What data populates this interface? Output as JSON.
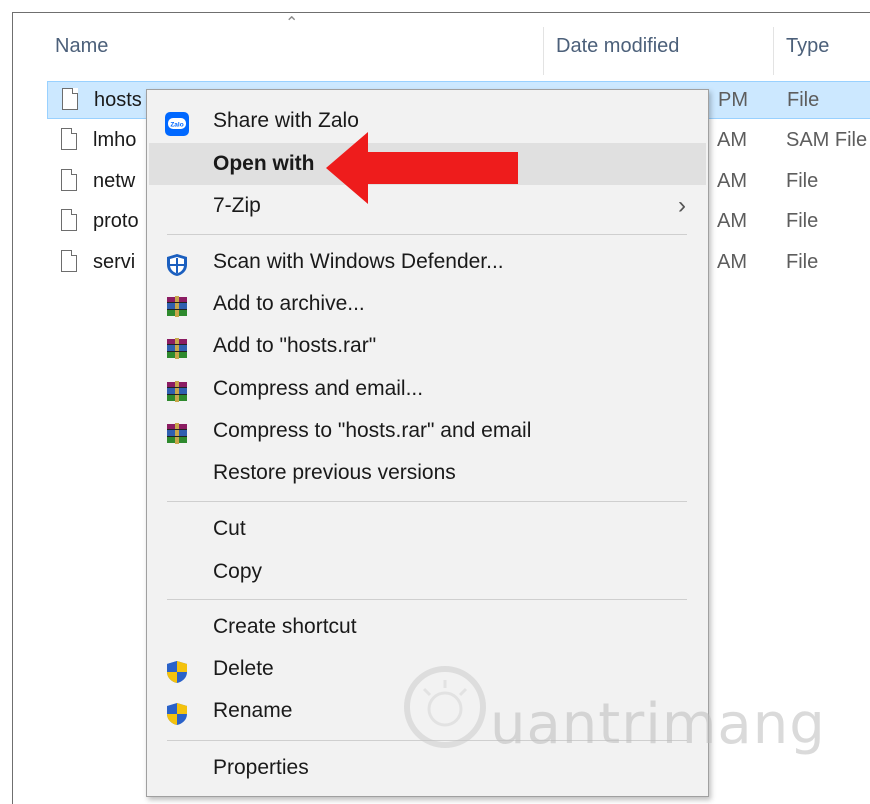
{
  "columns": {
    "name": "Name",
    "date_modified": "Date modified",
    "type": "Type"
  },
  "files": [
    {
      "name": "hosts",
      "date": "PM",
      "type": "File",
      "selected": true
    },
    {
      "name": "lmho",
      "date": "AM",
      "type": "SAM File",
      "selected": false
    },
    {
      "name": "netw",
      "date": "AM",
      "type": "File",
      "selected": false
    },
    {
      "name": "proto",
      "date": "AM",
      "type": "File",
      "selected": false
    },
    {
      "name": "servi",
      "date": "AM",
      "type": "File",
      "selected": false
    }
  ],
  "context_menu": {
    "share_with_zalo": "Share with Zalo",
    "zalo_icon_text": "Zalo",
    "open_with": "Open with",
    "seven_zip": "7-Zip",
    "scan_defender": "Scan with Windows Defender...",
    "add_to_archive": "Add to archive...",
    "add_to_rar": "Add to \"hosts.rar\"",
    "compress_email": "Compress and email...",
    "compress_rar_email": "Compress to \"hosts.rar\" and email",
    "restore_previous": "Restore previous versions",
    "cut": "Cut",
    "copy": "Copy",
    "create_shortcut": "Create shortcut",
    "delete": "Delete",
    "rename": "Rename",
    "properties": "Properties"
  },
  "icons": {
    "zalo": "zalo-icon",
    "defender": "windows-defender-icon",
    "winrar": "winrar-icon",
    "uac_shield": "uac-shield-icon",
    "submenu": "chevron-right-icon",
    "annotation": "red-arrow-icon"
  },
  "watermark": {
    "text": "uantrimang"
  },
  "colors": {
    "selection": "#cce8ff",
    "menu_bg": "#f2f2f2",
    "menu_hover": "#e0e0e0",
    "arrow": "#ee1c1c",
    "zalo_blue": "#0068ff"
  }
}
